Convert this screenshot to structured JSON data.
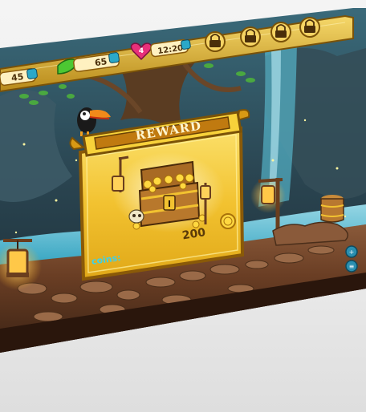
{
  "hud": {
    "stat1": "45",
    "stat2": "65",
    "heart_count": "4",
    "timer": "12:20",
    "lock_count": 4
  },
  "reward": {
    "title": "REWARD",
    "amount": "200",
    "coins_label": "coins:"
  },
  "colors": {
    "gold": "#f2c230",
    "gold_dark": "#b8860b",
    "cave_teal": "#2fa8b8",
    "heart_pink": "#e8307a",
    "gem_green": "#4cc832"
  },
  "icons": [
    "gem-icon",
    "leaf-gem-icon",
    "heart-icon",
    "clock-icon",
    "lock-icon",
    "plus-icon",
    "coin-icon",
    "treasure-chest-icon",
    "lantern-icon",
    "toucan-icon",
    "barrel-icon",
    "skull-icon"
  ]
}
